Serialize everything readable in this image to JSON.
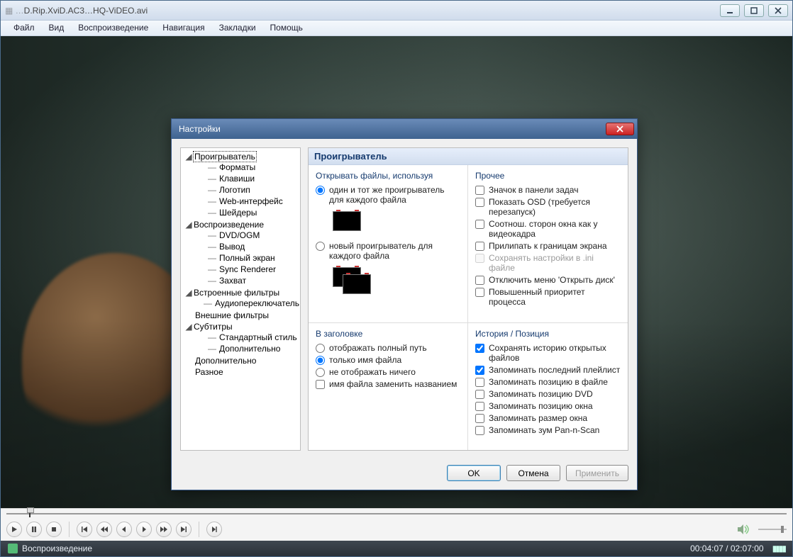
{
  "window": {
    "title_suffix": ".avi",
    "title_stub": "D.Rip.XviD.AC3…HQ-ViDEO"
  },
  "menubar": {
    "items": [
      "Файл",
      "Вид",
      "Воспроизведение",
      "Навигация",
      "Закладки",
      "Помощь"
    ]
  },
  "status": {
    "state": "Воспроизведение",
    "time_current": "00:04:07",
    "time_total": "02:07:00",
    "sep": " / "
  },
  "dialog": {
    "title": "Настройки",
    "header": "Проигрыватель",
    "tree": {
      "n0": "Проигрыватель",
      "n0c": [
        "Форматы",
        "Клавиши",
        "Логотип",
        "Web-интерфейс",
        "Шейдеры"
      ],
      "n1": "Воспроизведение",
      "n1c": [
        "DVD/OGM",
        "Вывод",
        "Полный экран",
        "Sync Renderer",
        "Захват"
      ],
      "n2": "Встроенные фильтры",
      "n2c": [
        "Аудиопереключатель"
      ],
      "n3": "Внешние фильтры",
      "n4": "Субтитры",
      "n4c": [
        "Стандартный стиль",
        "Дополнительно"
      ],
      "n5": "Дополнительно",
      "n6": "Разное"
    },
    "open_group": {
      "title": "Открывать файлы, используя",
      "r0": "один и тот же проигрыватель для каждого файла",
      "r1": "новый проигрыватель для каждого файла"
    },
    "header_group": {
      "title": "В заголовке",
      "r0": "отображать полный путь",
      "r1": "только имя файла",
      "r2": "не отображать ничего",
      "c0": "имя файла заменить названием"
    },
    "misc_group": {
      "title": "Прочее",
      "c0": "Значок в панели задач",
      "c1": "Показать OSD (требуется перезапуск)",
      "c2": "Соотнош. сторон окна как у видеокадра",
      "c3": "Прилипать к границам экрана",
      "c4": "Сохранять настройки в .ini файле",
      "c5": "Отключить меню 'Открыть диск'",
      "c6": "Повышенный приоритет процесса"
    },
    "history_group": {
      "title": "История / Позиция",
      "c0": "Сохранять историю открытых файлов",
      "c1": "Запоминать последний плейлист",
      "c2": "Запоминать позицию в файле",
      "c3": "Запоминать позицию DVD",
      "c4": "Запоминать позицию окна",
      "c5": "Запоминать размер окна",
      "c6": "Запоминать зум Pan-n-Scan"
    },
    "buttons": {
      "ok": "OK",
      "cancel": "Отмена",
      "apply": "Применить"
    }
  }
}
